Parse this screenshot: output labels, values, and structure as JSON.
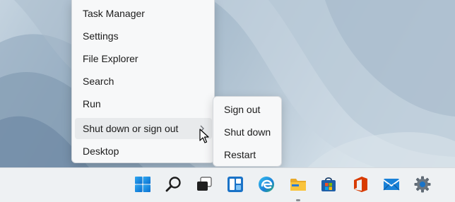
{
  "context_menu": {
    "items": [
      {
        "label": "Task Manager"
      },
      {
        "label": "Settings"
      },
      {
        "label": "File Explorer"
      },
      {
        "label": "Search"
      },
      {
        "label": "Run"
      },
      {
        "label": "Shut down or sign out",
        "has_submenu": true,
        "highlighted": true
      },
      {
        "label": "Desktop"
      }
    ],
    "submenu": {
      "items": [
        {
          "label": "Sign out"
        },
        {
          "label": "Shut down"
        },
        {
          "label": "Restart"
        }
      ]
    }
  },
  "taskbar": {
    "icons": [
      {
        "name": "start-icon"
      },
      {
        "name": "search-icon"
      },
      {
        "name": "task-view-icon"
      },
      {
        "name": "widgets-icon"
      },
      {
        "name": "edge-browser-icon"
      },
      {
        "name": "file-explorer-icon"
      },
      {
        "name": "microsoft-store-icon"
      },
      {
        "name": "office-icon"
      },
      {
        "name": "mail-icon"
      },
      {
        "name": "settings-gear-icon"
      }
    ]
  },
  "colors": {
    "accent": "#0078d4",
    "menu_background": "#f7f8f9",
    "highlight": "#e8eaec",
    "taskbar_background": "#eef1f3"
  }
}
